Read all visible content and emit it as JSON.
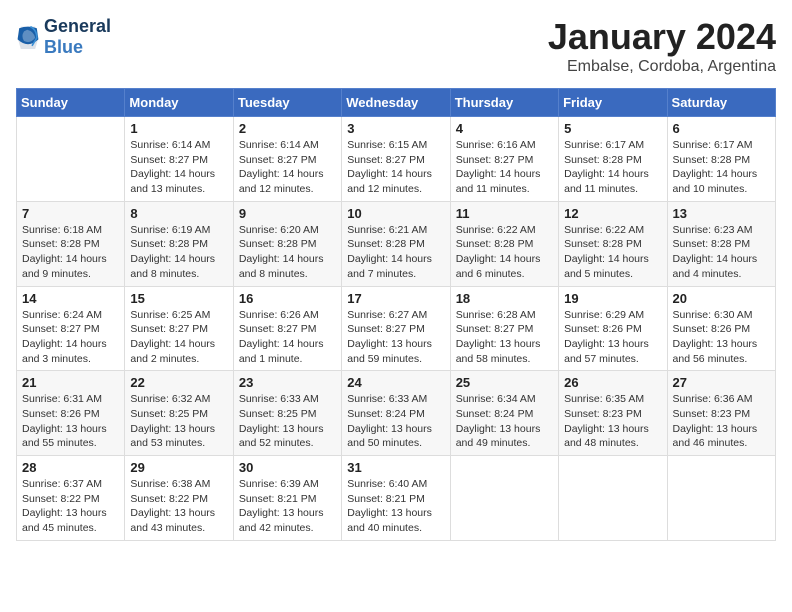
{
  "logo": {
    "text_general": "General",
    "text_blue": "Blue"
  },
  "title": "January 2024",
  "location": "Embalse, Cordoba, Argentina",
  "days_of_week": [
    "Sunday",
    "Monday",
    "Tuesday",
    "Wednesday",
    "Thursday",
    "Friday",
    "Saturday"
  ],
  "weeks": [
    [
      {
        "day": "",
        "info": ""
      },
      {
        "day": "1",
        "info": "Sunrise: 6:14 AM\nSunset: 8:27 PM\nDaylight: 14 hours\nand 13 minutes."
      },
      {
        "day": "2",
        "info": "Sunrise: 6:14 AM\nSunset: 8:27 PM\nDaylight: 14 hours\nand 12 minutes."
      },
      {
        "day": "3",
        "info": "Sunrise: 6:15 AM\nSunset: 8:27 PM\nDaylight: 14 hours\nand 12 minutes."
      },
      {
        "day": "4",
        "info": "Sunrise: 6:16 AM\nSunset: 8:27 PM\nDaylight: 14 hours\nand 11 minutes."
      },
      {
        "day": "5",
        "info": "Sunrise: 6:17 AM\nSunset: 8:28 PM\nDaylight: 14 hours\nand 11 minutes."
      },
      {
        "day": "6",
        "info": "Sunrise: 6:17 AM\nSunset: 8:28 PM\nDaylight: 14 hours\nand 10 minutes."
      }
    ],
    [
      {
        "day": "7",
        "info": "Sunrise: 6:18 AM\nSunset: 8:28 PM\nDaylight: 14 hours\nand 9 minutes."
      },
      {
        "day": "8",
        "info": "Sunrise: 6:19 AM\nSunset: 8:28 PM\nDaylight: 14 hours\nand 8 minutes."
      },
      {
        "day": "9",
        "info": "Sunrise: 6:20 AM\nSunset: 8:28 PM\nDaylight: 14 hours\nand 8 minutes."
      },
      {
        "day": "10",
        "info": "Sunrise: 6:21 AM\nSunset: 8:28 PM\nDaylight: 14 hours\nand 7 minutes."
      },
      {
        "day": "11",
        "info": "Sunrise: 6:22 AM\nSunset: 8:28 PM\nDaylight: 14 hours\nand 6 minutes."
      },
      {
        "day": "12",
        "info": "Sunrise: 6:22 AM\nSunset: 8:28 PM\nDaylight: 14 hours\nand 5 minutes."
      },
      {
        "day": "13",
        "info": "Sunrise: 6:23 AM\nSunset: 8:28 PM\nDaylight: 14 hours\nand 4 minutes."
      }
    ],
    [
      {
        "day": "14",
        "info": "Sunrise: 6:24 AM\nSunset: 8:27 PM\nDaylight: 14 hours\nand 3 minutes."
      },
      {
        "day": "15",
        "info": "Sunrise: 6:25 AM\nSunset: 8:27 PM\nDaylight: 14 hours\nand 2 minutes."
      },
      {
        "day": "16",
        "info": "Sunrise: 6:26 AM\nSunset: 8:27 PM\nDaylight: 14 hours\nand 1 minute."
      },
      {
        "day": "17",
        "info": "Sunrise: 6:27 AM\nSunset: 8:27 PM\nDaylight: 13 hours\nand 59 minutes."
      },
      {
        "day": "18",
        "info": "Sunrise: 6:28 AM\nSunset: 8:27 PM\nDaylight: 13 hours\nand 58 minutes."
      },
      {
        "day": "19",
        "info": "Sunrise: 6:29 AM\nSunset: 8:26 PM\nDaylight: 13 hours\nand 57 minutes."
      },
      {
        "day": "20",
        "info": "Sunrise: 6:30 AM\nSunset: 8:26 PM\nDaylight: 13 hours\nand 56 minutes."
      }
    ],
    [
      {
        "day": "21",
        "info": "Sunrise: 6:31 AM\nSunset: 8:26 PM\nDaylight: 13 hours\nand 55 minutes."
      },
      {
        "day": "22",
        "info": "Sunrise: 6:32 AM\nSunset: 8:25 PM\nDaylight: 13 hours\nand 53 minutes."
      },
      {
        "day": "23",
        "info": "Sunrise: 6:33 AM\nSunset: 8:25 PM\nDaylight: 13 hours\nand 52 minutes."
      },
      {
        "day": "24",
        "info": "Sunrise: 6:33 AM\nSunset: 8:24 PM\nDaylight: 13 hours\nand 50 minutes."
      },
      {
        "day": "25",
        "info": "Sunrise: 6:34 AM\nSunset: 8:24 PM\nDaylight: 13 hours\nand 49 minutes."
      },
      {
        "day": "26",
        "info": "Sunrise: 6:35 AM\nSunset: 8:23 PM\nDaylight: 13 hours\nand 48 minutes."
      },
      {
        "day": "27",
        "info": "Sunrise: 6:36 AM\nSunset: 8:23 PM\nDaylight: 13 hours\nand 46 minutes."
      }
    ],
    [
      {
        "day": "28",
        "info": "Sunrise: 6:37 AM\nSunset: 8:22 PM\nDaylight: 13 hours\nand 45 minutes."
      },
      {
        "day": "29",
        "info": "Sunrise: 6:38 AM\nSunset: 8:22 PM\nDaylight: 13 hours\nand 43 minutes."
      },
      {
        "day": "30",
        "info": "Sunrise: 6:39 AM\nSunset: 8:21 PM\nDaylight: 13 hours\nand 42 minutes."
      },
      {
        "day": "31",
        "info": "Sunrise: 6:40 AM\nSunset: 8:21 PM\nDaylight: 13 hours\nand 40 minutes."
      },
      {
        "day": "",
        "info": ""
      },
      {
        "day": "",
        "info": ""
      },
      {
        "day": "",
        "info": ""
      }
    ]
  ]
}
